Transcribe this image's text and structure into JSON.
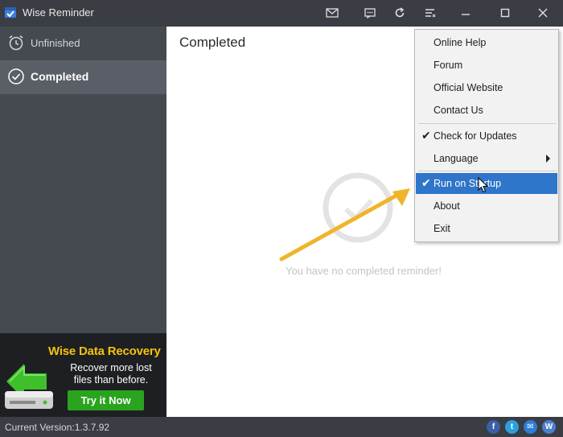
{
  "window": {
    "title": "Wise Reminder"
  },
  "titlebar": {
    "icons": [
      "mail-icon",
      "feedback-icon",
      "refresh-icon",
      "menu-icon",
      "minimize-icon",
      "maximize-icon",
      "close-icon"
    ]
  },
  "sidebar": {
    "items": [
      {
        "label": "Unfinished",
        "icon": "alarm-clock-icon",
        "active": false
      },
      {
        "label": "Completed",
        "icon": "check-circle-icon",
        "active": true
      }
    ]
  },
  "ad": {
    "title": "Wise Data Recovery",
    "subtitle_line1": "Recover more lost",
    "subtitle_line2": "files than before.",
    "button": "Try it Now",
    "title_color": "#f1c40f",
    "button_color": "#2aa31e"
  },
  "main": {
    "title": "Completed",
    "empty_message": "You have no completed reminder!"
  },
  "menu": {
    "items": [
      {
        "label": "Online Help",
        "checked": false
      },
      {
        "label": "Forum",
        "checked": false
      },
      {
        "label": "Official Website",
        "checked": false
      },
      {
        "label": "Contact Us",
        "checked": false
      },
      {
        "label": "Check for Updates",
        "checked": true
      },
      {
        "label": "Language",
        "checked": false,
        "submenu": true
      },
      {
        "label": "Run on Startup",
        "checked": true,
        "highlighted": true
      },
      {
        "label": "About",
        "checked": false
      },
      {
        "label": "Exit",
        "checked": false
      }
    ],
    "check_glyph": "✔",
    "highlight_color": "#2f75c9"
  },
  "status": {
    "version": "Current Version:1.3.7.92",
    "social": [
      "facebook-icon",
      "twitter-icon",
      "email-icon",
      "wise-icon"
    ],
    "social_letters": [
      "f",
      "t",
      "✉",
      "W"
    ]
  },
  "colors": {
    "titlebar": "#3a3d43",
    "sidebar": "#454950",
    "annotation_arrow": "#f0b429"
  }
}
